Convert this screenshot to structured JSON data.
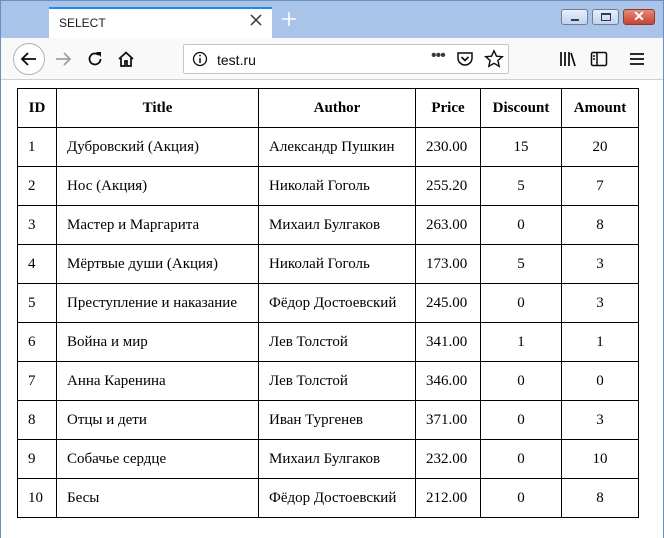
{
  "window": {
    "tab_title": "SELECT",
    "tab_close_icon": "close-icon",
    "new_tab_icon": "plus-icon",
    "controls": [
      "minimize-icon",
      "maximize-icon",
      "close-icon"
    ]
  },
  "toolbar": {
    "url": "test.ru",
    "icons": [
      "back-arrow-icon",
      "forward-arrow-icon",
      "reload-icon",
      "home-icon",
      "info-icon",
      "more-dots-icon",
      "pocket-icon",
      "bookmark-star-icon",
      "library-icon",
      "sidebar-icon",
      "menu-icon"
    ]
  },
  "table": {
    "headers": {
      "id": "ID",
      "title": "Title",
      "author": "Author",
      "price": "Price",
      "discount": "Discount",
      "amount": "Amount"
    },
    "rows": [
      {
        "id": "1",
        "title": "Дубровский (Акция)",
        "author": "Александр Пушкин",
        "price": "230.00",
        "discount": "15",
        "amount": "20"
      },
      {
        "id": "2",
        "title": "Нос (Акция)",
        "author": "Николай Гоголь",
        "price": "255.20",
        "discount": "5",
        "amount": "7"
      },
      {
        "id": "3",
        "title": "Мастер и Маргарита",
        "author": "Михаил Булгаков",
        "price": "263.00",
        "discount": "0",
        "amount": "8"
      },
      {
        "id": "4",
        "title": "Мёртвые души (Акция)",
        "author": "Николай Гоголь",
        "price": "173.00",
        "discount": "5",
        "amount": "3"
      },
      {
        "id": "5",
        "title": "Преступление и наказание",
        "author": "Фёдор Достоевский",
        "price": "245.00",
        "discount": "0",
        "amount": "3"
      },
      {
        "id": "6",
        "title": "Война и мир",
        "author": "Лев Толстой",
        "price": "341.00",
        "discount": "1",
        "amount": "1"
      },
      {
        "id": "7",
        "title": "Анна Каренина",
        "author": "Лев Толстой",
        "price": "346.00",
        "discount": "0",
        "amount": "0"
      },
      {
        "id": "8",
        "title": "Отцы и дети",
        "author": "Иван Тургенев",
        "price": "371.00",
        "discount": "0",
        "amount": "3"
      },
      {
        "id": "9",
        "title": "Собачье сердце",
        "author": "Михаил Булгаков",
        "price": "232.00",
        "discount": "0",
        "amount": "10"
      },
      {
        "id": "10",
        "title": "Бесы",
        "author": "Фёдор Достоевский",
        "price": "212.00",
        "discount": "0",
        "amount": "8"
      }
    ]
  },
  "colors": {
    "titlebar": "#a9c4e8",
    "tab_accent": "#1e88f5",
    "toolbar": "#f9f9fa"
  }
}
